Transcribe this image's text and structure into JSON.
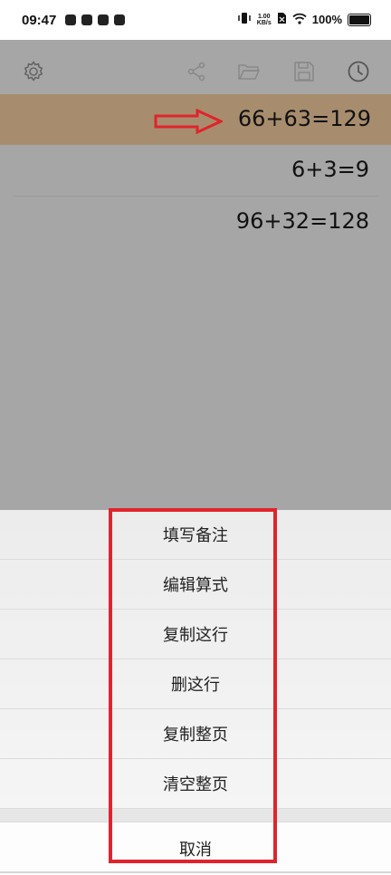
{
  "status_bar": {
    "time": "09:47",
    "net_speed_value": "1.00",
    "net_speed_unit": "KB/s",
    "battery_percent": "100%"
  },
  "toolbar": {
    "icons": [
      "settings-gear-icon",
      "share-icon",
      "folder-open-icon",
      "save-floppy-icon",
      "history-clock-icon"
    ]
  },
  "calculations": [
    {
      "expression": "66+63=129",
      "selected": true
    },
    {
      "expression": "6+3=9",
      "selected": false
    },
    {
      "expression": "96+32=128",
      "selected": false
    }
  ],
  "action_sheet": {
    "items": [
      "填写备注",
      "编辑算式",
      "复制这行",
      "删这行",
      "复制整页",
      "清空整页"
    ],
    "cancel": "取消"
  },
  "colors": {
    "selected_row": "#a78d6d",
    "overlay_gray": "#a6a6a6",
    "annotation_red": "#e0242c"
  }
}
